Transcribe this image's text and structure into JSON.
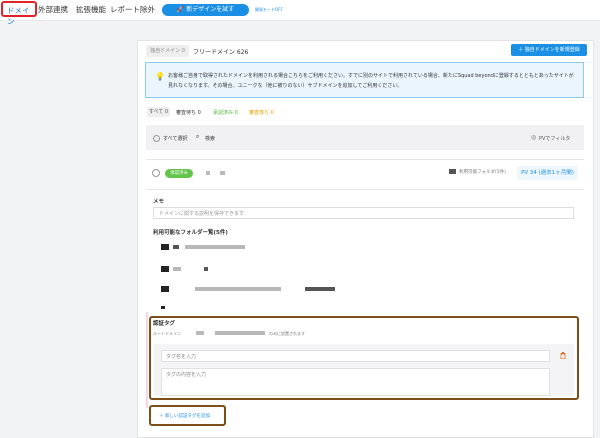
{
  "nav": {
    "domain": "ドメイン",
    "external": "外部連携",
    "extensions": "拡張機能",
    "report_exclusion": "レポート除外",
    "try_new_design": "新デザインを試す",
    "dev_mode": "開発モードOFF"
  },
  "header": {
    "tab_custom": "独自ドメイン 0",
    "tab_free": "フリードメイン 626",
    "register_button": "独自ドメインを新規登録"
  },
  "notice": {
    "text": "お客様ご自身で取得されたドメインを利用される場合こちらをご利用ください。すでに別のサイトで利用されている場合、新たにSquad beyondに登録するとともとあったサイトが見れなくなります。その場合、ユニークな（他に被りのない）サブドメインを追加してご利用ください。"
  },
  "filters": {
    "all": "すべて 0",
    "pending": "審査待ち 0",
    "approved": "承認済み 0",
    "rejected": "審査落ち 0"
  },
  "toolbar": {
    "select_all": "すべて選択",
    "search": "検索",
    "pv_filter": "PVでフィルタ"
  },
  "domain_row": {
    "status": "承認済み",
    "folders_label": "利用可能フォルダ(5件)",
    "pv": "PV 34 (過去1ヶ月間)"
  },
  "memo": {
    "label": "メモ",
    "placeholder": "ドメインに関する説明を保存できます"
  },
  "folders": {
    "label": "利用可能なフォルダー覧(5件)"
  },
  "auth_tag": {
    "title": "認証タグ",
    "route_label": "ルートドメイン",
    "only_note": "のみに設置されます",
    "name_placeholder": "タグ名を入力",
    "content_placeholder": "タグの内容を入力",
    "add_button": "新しい認証タグを追加"
  },
  "colors": {
    "accent": "#1a8fe3",
    "highlight_red": "#e0242a",
    "highlight_brown": "#7d4f18",
    "approved_green": "#62c44a"
  }
}
